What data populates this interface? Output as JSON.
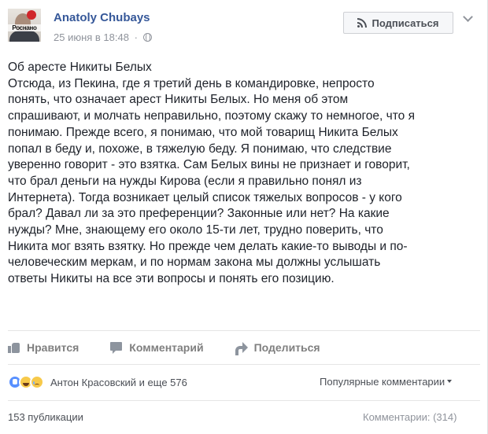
{
  "post": {
    "author": "Anatoly Chubays",
    "date": "25 июня в 18:48",
    "separator": "·",
    "avatar_label": "Роснано",
    "subscribe_label": "Подписаться",
    "text_lines": [
      "Об аресте Никиты Белых",
      "Отсюда, из Пекина, где я третий день в командировке, непросто",
      "понять, что означает арест Никиты Белых. Но меня об этом",
      "спрашивают, и молчать неправильно, поэтому скажу то немногое, что я",
      "понимаю. Прежде всего, я понимаю, что мой товарищ Никита Белых",
      "попал в беду и, похоже, в тяжелую беду. Я понимаю, что следствие",
      "уверенно говорит - это взятка. Сам Белых вины не признает и говорит,",
      "что брал деньги на нужды Кирова (если я правильно понял из",
      "Интернета). Тогда возникает целый список тяжелых вопросов - у кого",
      "брал? Давал ли за это преференции? Законные или нет? На какие",
      "нужды? Мне, знающему его около 15-ти лет, трудно поверить, что",
      "Никита мог взять взятку. Но прежде чем делать какие-то выводы и по-",
      "человеческим меркам, и по нормам закона мы должны услышать",
      "ответы Никиты на все эти вопросы и понять его позицию."
    ]
  },
  "actions": {
    "like": "Нравится",
    "comment": "Комментарий",
    "share": "Поделиться"
  },
  "reactions": {
    "icons": [
      "like",
      "haha",
      "sad"
    ],
    "summary": "Антон Красовский и еще 576",
    "sort_label": "Популярные комментарии"
  },
  "footer": {
    "shares": "153 публикации",
    "comments": "Комментарии: (314)"
  },
  "colors": {
    "link": "#365899",
    "muted": "#90949c",
    "like_blue": "#5890ff",
    "emoji_yellow": "#f7c94a"
  }
}
